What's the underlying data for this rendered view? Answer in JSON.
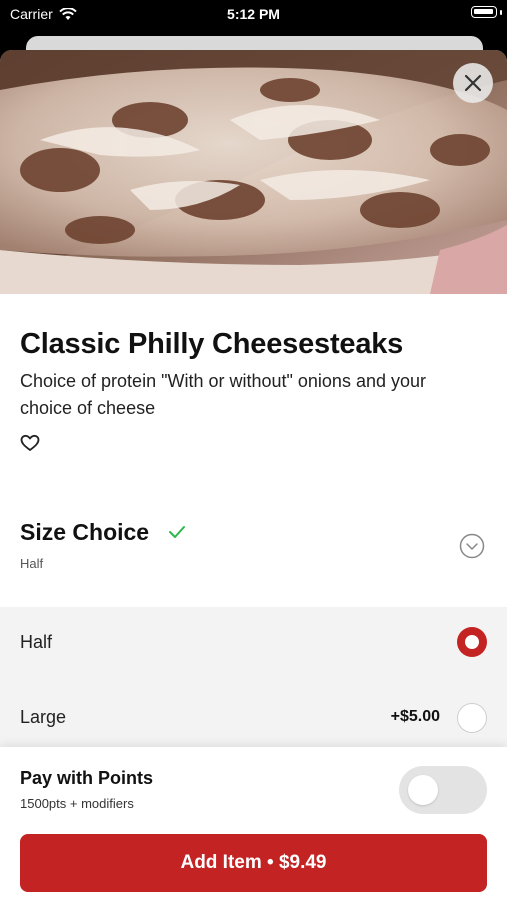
{
  "status": {
    "carrier": "Carrier",
    "time": "5:12 PM"
  },
  "item": {
    "title": "Classic Philly Cheesesteaks",
    "description": "Choice of protein \"With or without\" onions and your choice of cheese"
  },
  "size_choice": {
    "title": "Size Choice",
    "selected": "Half",
    "options": [
      {
        "label": "Half",
        "price": "",
        "selected": true
      },
      {
        "label": "Large",
        "price": "+$5.00",
        "selected": false
      }
    ]
  },
  "points": {
    "title": "Pay with Points",
    "subtitle": "1500pts + modifiers",
    "enabled": false
  },
  "cta": {
    "label": "Add Item • $9.49"
  },
  "colors": {
    "accent": "#c42323",
    "check": "#2db84d"
  },
  "icons": [
    "wifi-icon",
    "battery-icon",
    "close-icon",
    "heart-icon",
    "check-icon",
    "chevron-down-icon"
  ]
}
